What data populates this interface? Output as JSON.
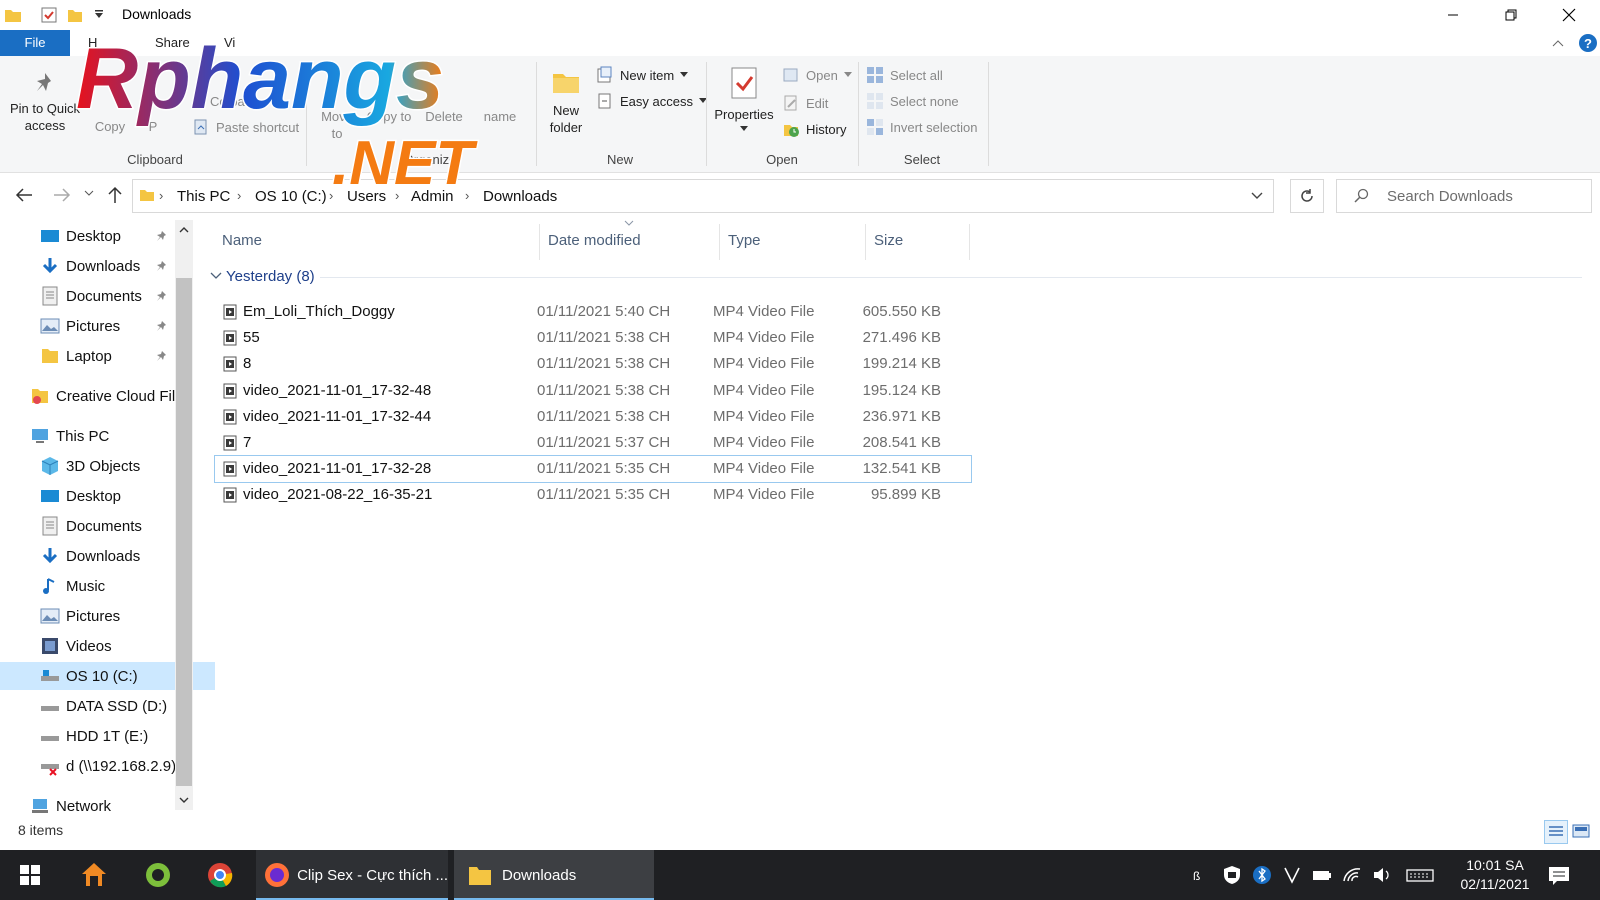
{
  "window": {
    "title": "Downloads"
  },
  "ribbon_tabs": {
    "file": "File",
    "home": "H",
    "share": "Share",
    "view": "Vi"
  },
  "ribbon": {
    "clipboard": {
      "label": "Clipboard",
      "pin": "Pin to Quick access",
      "copy": "Copy",
      "paste": "P",
      "copy_path": "Co  path",
      "paste_shortcut": "Paste shortcut"
    },
    "organize": {
      "label": "Organize",
      "move_to": "Move to",
      "copy_to": "Copy to",
      "delete": "Delete",
      "rename": "name"
    },
    "new": {
      "label": "New",
      "new_folder": "New folder",
      "new_item": "New item",
      "easy_access": "Easy access"
    },
    "open": {
      "label": "Open",
      "properties": "Properties",
      "open": "Open",
      "edit": "Edit",
      "history": "History"
    },
    "select": {
      "label": "Select",
      "select_all": "Select all",
      "select_none": "Select none",
      "invert": "Invert selection"
    }
  },
  "address": {
    "crumbs": [
      "This PC",
      "OS 10 (C:)",
      "Users",
      "Admin",
      "Downloads"
    ],
    "search_placeholder": "Search Downloads"
  },
  "nav": {
    "quick": [
      "Desktop",
      "Downloads",
      "Documents",
      "Pictures",
      "Laptop"
    ],
    "creative_cloud": "Creative Cloud Files",
    "this_pc": "This PC",
    "pc_items": [
      "3D Objects",
      "Desktop",
      "Documents",
      "Downloads",
      "Music",
      "Pictures",
      "Videos",
      "OS 10 (C:)",
      "DATA SSD (D:)",
      "HDD 1T (E:)",
      "d (\\\\192.168.2.9)"
    ],
    "network": "Network"
  },
  "columns": {
    "name": "Name",
    "date": "Date modified",
    "type": "Type",
    "size": "Size"
  },
  "group": {
    "label": "Yesterday (8)"
  },
  "files": [
    {
      "name": "Em_Loli_Thích_Doggy",
      "date": "01/11/2021 5:40 CH",
      "type": "MP4 Video File",
      "size": "605.550 KB"
    },
    {
      "name": "55",
      "date": "01/11/2021 5:38 CH",
      "type": "MP4 Video File",
      "size": "271.496 KB"
    },
    {
      "name": "8",
      "date": "01/11/2021 5:38 CH",
      "type": "MP4 Video File",
      "size": "199.214 KB"
    },
    {
      "name": "video_2021-11-01_17-32-48",
      "date": "01/11/2021 5:38 CH",
      "type": "MP4 Video File",
      "size": "195.124 KB"
    },
    {
      "name": "video_2021-11-01_17-32-44",
      "date": "01/11/2021 5:38 CH",
      "type": "MP4 Video File",
      "size": "236.971 KB"
    },
    {
      "name": "7",
      "date": "01/11/2021 5:37 CH",
      "type": "MP4 Video File",
      "size": "208.541 KB"
    },
    {
      "name": "video_2021-11-01_17-32-28",
      "date": "01/11/2021 5:35 CH",
      "type": "MP4 Video File",
      "size": "132.541 KB"
    },
    {
      "name": "video_2021-08-22_16-35-21",
      "date": "01/11/2021 5:35 CH",
      "type": "MP4 Video File",
      "size": "95.899 KB"
    }
  ],
  "status": {
    "items": "8 items"
  },
  "taskbar": {
    "firefox_window": "Clip Sex - Cực thích ...",
    "explorer_window": "Downloads",
    "time": "10:01 SA",
    "date": "02/11/2021"
  },
  "watermark": {
    "brand": "Rphangs",
    "suffix": ".NET"
  },
  "colors": {
    "accent": "#1a6ec3",
    "selection": "#cce8ff",
    "taskbar": "#1f2023",
    "group_header": "#1e3f8a"
  }
}
